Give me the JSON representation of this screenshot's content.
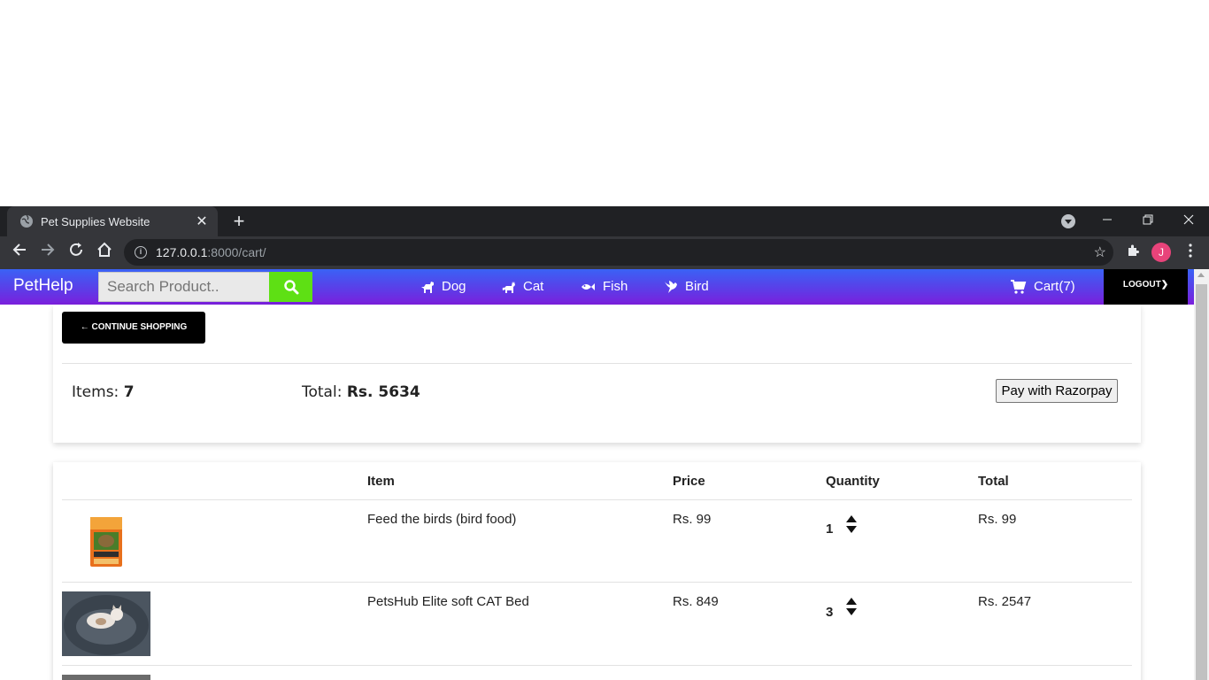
{
  "browser": {
    "tab_title": "Pet Supplies Website",
    "tab_close": "✕",
    "new_tab": "+",
    "url_host": "127.0.0.1",
    "url_rest": ":8000/cart/",
    "avatar_letter": "J"
  },
  "navbar": {
    "brand": "PetHelp",
    "search_placeholder": "Search Product..",
    "links": [
      {
        "label": "Dog",
        "icon": "dog-icon"
      },
      {
        "label": "Cat",
        "icon": "cat-icon"
      },
      {
        "label": "Fish",
        "icon": "fish-icon"
      },
      {
        "label": "Bird",
        "icon": "bird-icon"
      }
    ],
    "cart_label": "Cart(7)",
    "logout_label": "LOGOUT❯",
    "colors": {
      "gradient_top": "#3a62f5",
      "gradient_bottom": "#7b1fdc",
      "search_button": "#5ee014"
    }
  },
  "summary": {
    "continue_label": "← CONTINUE SHOPPING",
    "items_label": "Items:",
    "items_value": "7",
    "total_label": "Total:",
    "total_value": "Rs. 5634",
    "pay_label": "Pay with Razorpay"
  },
  "table": {
    "headers": [
      "Item",
      "Price",
      "Quantity",
      "Total"
    ],
    "rows": [
      {
        "name": "Feed the birds (bird food)",
        "price": "Rs. 99",
        "quantity": "1",
        "total": "Rs. 99",
        "thumb": "bird-food-box-image"
      },
      {
        "name": "PetsHub Elite soft CAT Bed",
        "price": "Rs. 849",
        "quantity": "3",
        "total": "Rs. 2547",
        "thumb": "cat-bed-image"
      }
    ]
  }
}
